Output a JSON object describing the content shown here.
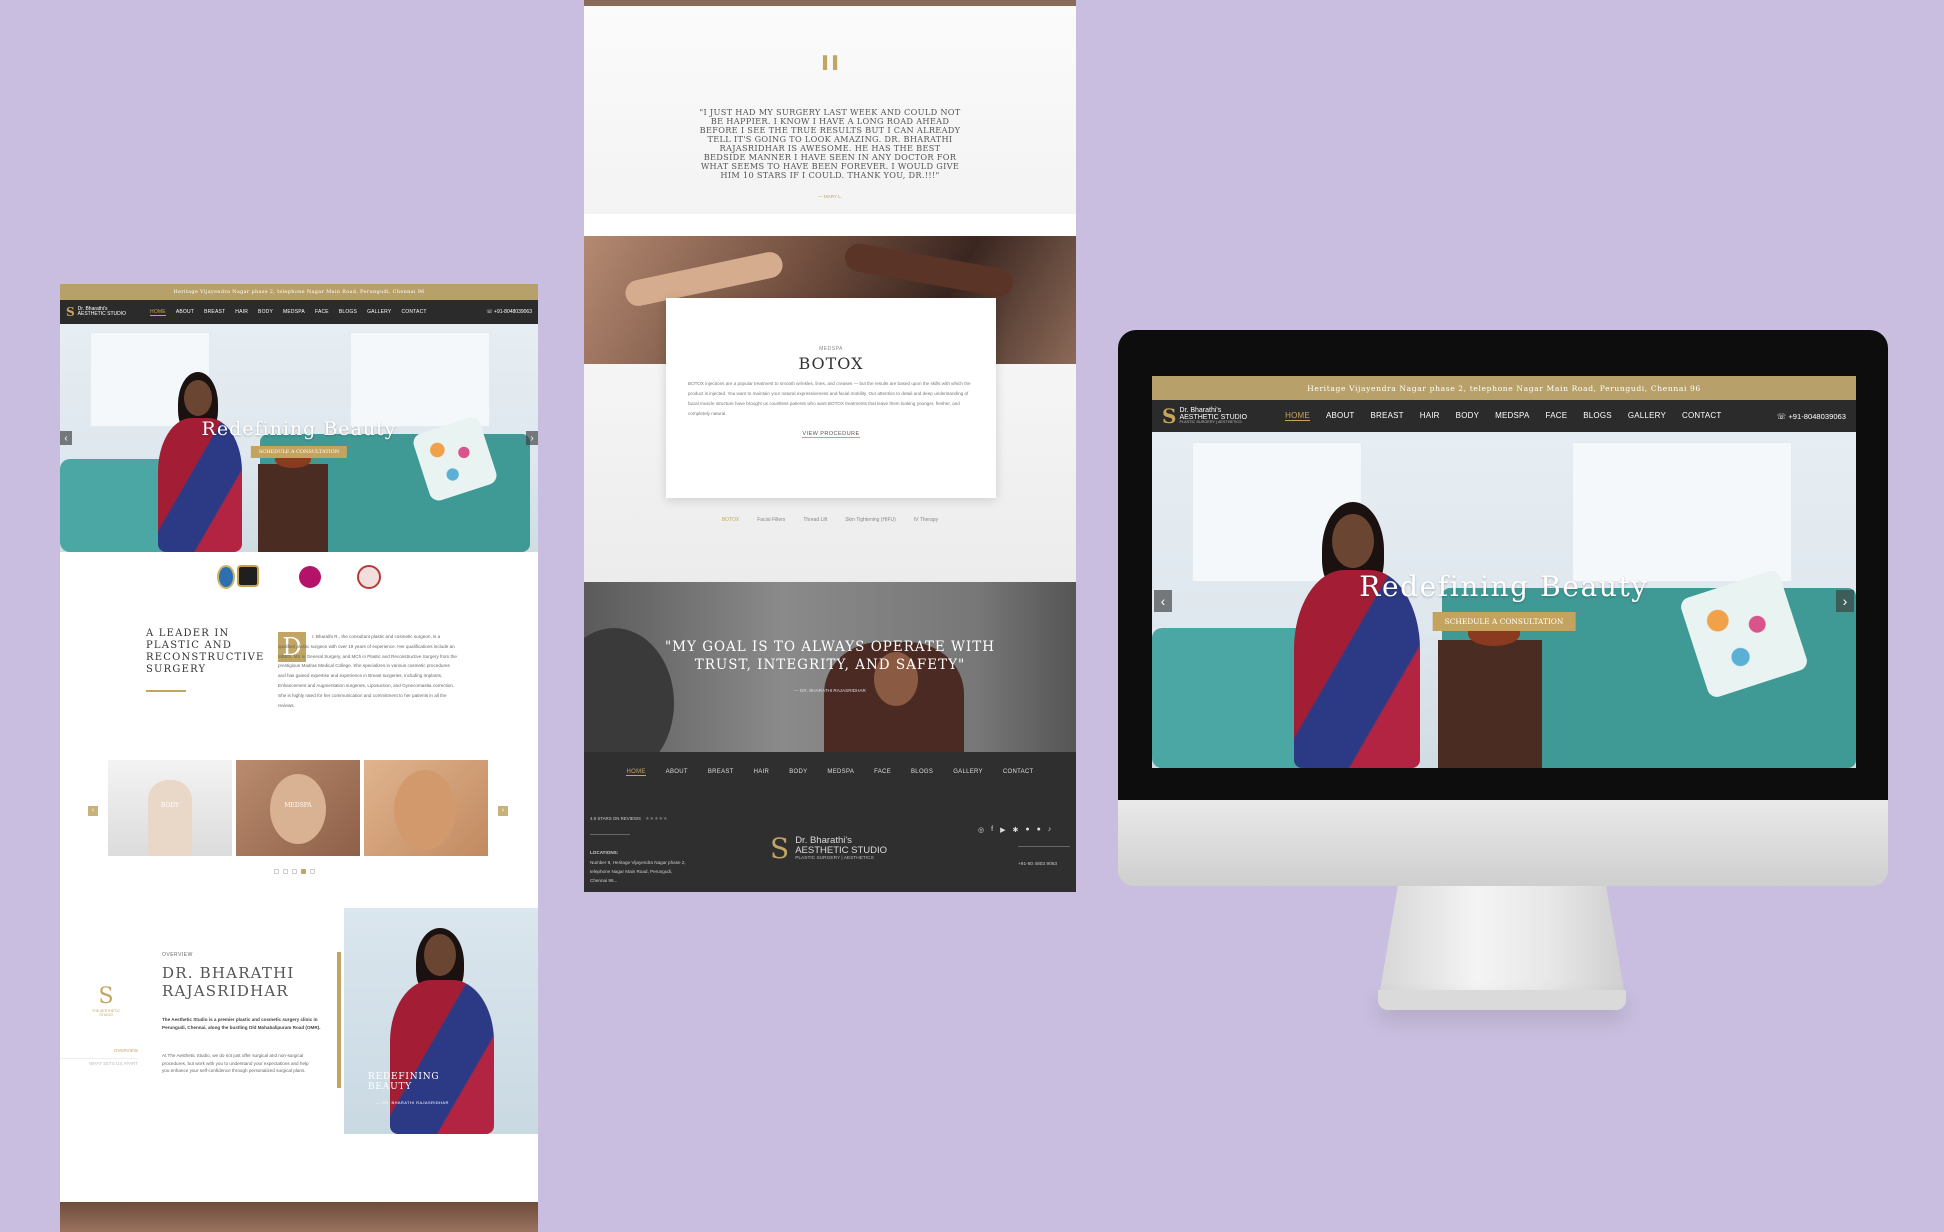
{
  "site": {
    "topbar_address": "Heritage Vijayendra Nagar phase 2, telephone Nagar Main Road, Perungudi, Chennai 96",
    "logo_line1": "Dr. Bharathi's",
    "logo_line2": "AESTHETIC STUDIO",
    "logo_line3": "PLASTIC SURGERY | AESTHETICS",
    "phone": "+91-8048039063",
    "nav": [
      "HOME",
      "ABOUT",
      "BREAST",
      "HAIR",
      "BODY",
      "MEDSPA",
      "FACE",
      "BLOGS",
      "GALLERY",
      "CONTACT"
    ],
    "hero_title": "Redefining Beauty",
    "hero_button": "SCHEDULE A CONSULTATION",
    "prev_arrow": "‹",
    "next_arrow": "›"
  },
  "left": {
    "leader_heading": "A Leader in Plastic and Reconstructive Surgery",
    "dropcap": "D",
    "leader_text": "r. Bharathi R., the consultant plastic and cosmetic surgeon, is a qualified plastic surgeon with over 19 years of experience. Her qualifications include an MBBS, MS in General Surgery, and MCh in Plastic and Reconstructive Surgery from the prestigious Madras Medical College. She specializes in various cosmetic procedures and has gained expertise and experience in Breast surgeries, including Implants, Enhancement and Augmentation surgeries, Liposuction, and Gynecomastia correction. She is highly rated for her communication and commitment to her patients in all the reviews.",
    "cards": [
      "BODY",
      "MEDSPA",
      ""
    ],
    "overview_label": "OVERVIEW",
    "doctor_name_1": "Dr. Bharathi",
    "doctor_name_2": "Rajasridhar",
    "overview_logo_text": "THE AESTHETIC STUDIO",
    "side_link_1": "OVERVIEW",
    "side_link_2": "WHAT SETS US APART",
    "overview_p1": "The Aesthetic Studio is a premier plastic and cosmetic surgery clinic in Perungudi, Chennai, along the bustling Old Mahabalipuram Road (OMR).",
    "overview_p2": "At The Aesthetic Studio, we do not just offer surgical and non-surgical procedures, but work with you to understand your expectations and help you enhance your self-confidence through personalized surgical plans.",
    "photo_caption_1": "REDEFINING",
    "photo_caption_2": "BEAUTY",
    "photo_caption_3": "— DR. BHARATHI RAJASRIDHAR"
  },
  "mid": {
    "testimonial": "\"I just had my surgery last week and could not be happier. I know I have a long road ahead before I see the true results but I can already tell it's going to look amazing. Dr. Bharathi Rajasridhar is awesome. He has the best bedside manner I have seen in any doctor for what seems to have been forever. I would give him 10 stars if I could. Thank you, Dr.!!!\"",
    "testimonial_author": "— MARY L.",
    "card_label": "MEDSPA",
    "card_title": "BOTOX",
    "card_text": "BOTOX injections are a popular treatment to smooth wrinkles, lines, and creases — but the results are based upon the skills with which the product is injected. You want to maintain your natural expressiveness and facial mobility. Our attention to detail and deep understanding of facial muscle structure have brought us countless patients who want BOTOX treatments that leave them looking younger, fresher, and completely natural.",
    "card_link": "VIEW PROCEDURE",
    "tabs": [
      "BOTOX",
      "Facial Fillers",
      "Thread Lift",
      "Skin Tightening (HIFU)",
      "IV Therapy"
    ],
    "quote": "\"My goal is to always operate with trust, integrity, and safety\"",
    "quote_author": "— DR. BHARATHI RAJASRIDHAR",
    "footer_nav": [
      "HOME",
      "ABOUT",
      "BREAST",
      "HAIR",
      "BODY",
      "MEDSPA",
      "FACE",
      "BLOGS",
      "GALLERY",
      "CONTACT"
    ],
    "rating_label": "4.9 STARS ON REVIEWS",
    "stars": "★★★★★",
    "locations_label": "LOCATIONS:",
    "location_address": "Number 8, Heritage Vijayendra Nagar phase 2, telephone Nagar Main Road, Perungudi, Chennai 96...",
    "footer_logo_1": "Dr. Bharathi's",
    "footer_logo_2": "AESTHETIC STUDIO",
    "footer_logo_3": "PLASTIC SURGERY | AESTHETICS",
    "footer_phone": "+91-80 4803 9063",
    "social_icons": [
      "instagram-icon",
      "facebook-icon",
      "youtube-icon",
      "yelp-icon",
      "chat-icon",
      "wechat-icon",
      "tiktok-icon"
    ]
  },
  "colors": {
    "gold": "#c2a563",
    "dark": "#2b2b2b",
    "background": "#c9bedf"
  }
}
